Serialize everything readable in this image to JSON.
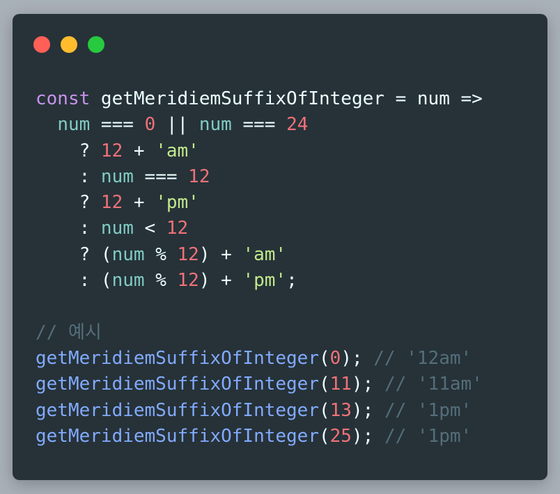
{
  "window": {
    "controls": [
      {
        "name": "close",
        "color": "#ff5f56"
      },
      {
        "name": "minimize",
        "color": "#ffbd2e"
      },
      {
        "name": "maximize",
        "color": "#27c93f"
      }
    ]
  },
  "code": {
    "lines": [
      [
        {
          "t": "const",
          "c": "kw"
        },
        {
          "t": " getMeridiemSuffixOfInteger",
          "c": "id"
        },
        {
          "t": " = ",
          "c": "op"
        },
        {
          "t": "num",
          "c": "id"
        },
        {
          "t": " =>",
          "c": "op"
        }
      ],
      [
        {
          "t": "  ",
          "c": "op"
        },
        {
          "t": "num",
          "c": "var"
        },
        {
          "t": " === ",
          "c": "op"
        },
        {
          "t": "0",
          "c": "num"
        },
        {
          "t": " || ",
          "c": "op"
        },
        {
          "t": "num",
          "c": "var"
        },
        {
          "t": " === ",
          "c": "op"
        },
        {
          "t": "24",
          "c": "num"
        }
      ],
      [
        {
          "t": "    ? ",
          "c": "op"
        },
        {
          "t": "12",
          "c": "num"
        },
        {
          "t": " + ",
          "c": "op"
        },
        {
          "t": "'am'",
          "c": "str"
        }
      ],
      [
        {
          "t": "    : ",
          "c": "op"
        },
        {
          "t": "num",
          "c": "var"
        },
        {
          "t": " === ",
          "c": "op"
        },
        {
          "t": "12",
          "c": "num"
        }
      ],
      [
        {
          "t": "    ? ",
          "c": "op"
        },
        {
          "t": "12",
          "c": "num"
        },
        {
          "t": " + ",
          "c": "op"
        },
        {
          "t": "'pm'",
          "c": "str"
        }
      ],
      [
        {
          "t": "    : ",
          "c": "op"
        },
        {
          "t": "num",
          "c": "var"
        },
        {
          "t": " < ",
          "c": "op"
        },
        {
          "t": "12",
          "c": "num"
        }
      ],
      [
        {
          "t": "    ? (",
          "c": "op"
        },
        {
          "t": "num",
          "c": "var"
        },
        {
          "t": " % ",
          "c": "op"
        },
        {
          "t": "12",
          "c": "num"
        },
        {
          "t": ") + ",
          "c": "op"
        },
        {
          "t": "'am'",
          "c": "str"
        }
      ],
      [
        {
          "t": "    : (",
          "c": "op"
        },
        {
          "t": "num",
          "c": "var"
        },
        {
          "t": " % ",
          "c": "op"
        },
        {
          "t": "12",
          "c": "num"
        },
        {
          "t": ") + ",
          "c": "op"
        },
        {
          "t": "'pm'",
          "c": "str"
        },
        {
          "t": ";",
          "c": "op"
        }
      ],
      [],
      [
        {
          "t": "// 예시",
          "c": "cm"
        }
      ],
      [
        {
          "t": "getMeridiemSuffixOfInteger",
          "c": "fn"
        },
        {
          "t": "(",
          "c": "op"
        },
        {
          "t": "0",
          "c": "num"
        },
        {
          "t": "); ",
          "c": "op"
        },
        {
          "t": "// '12am'",
          "c": "cm"
        }
      ],
      [
        {
          "t": "getMeridiemSuffixOfInteger",
          "c": "fn"
        },
        {
          "t": "(",
          "c": "op"
        },
        {
          "t": "11",
          "c": "num"
        },
        {
          "t": "); ",
          "c": "op"
        },
        {
          "t": "// '11am'",
          "c": "cm"
        }
      ],
      [
        {
          "t": "getMeridiemSuffixOfInteger",
          "c": "fn"
        },
        {
          "t": "(",
          "c": "op"
        },
        {
          "t": "13",
          "c": "num"
        },
        {
          "t": "); ",
          "c": "op"
        },
        {
          "t": "// '1pm'",
          "c": "cm"
        }
      ],
      [
        {
          "t": "getMeridiemSuffixOfInteger",
          "c": "fn"
        },
        {
          "t": "(",
          "c": "op"
        },
        {
          "t": "25",
          "c": "num"
        },
        {
          "t": "); ",
          "c": "op"
        },
        {
          "t": "// '1pm'",
          "c": "cm"
        }
      ]
    ]
  }
}
